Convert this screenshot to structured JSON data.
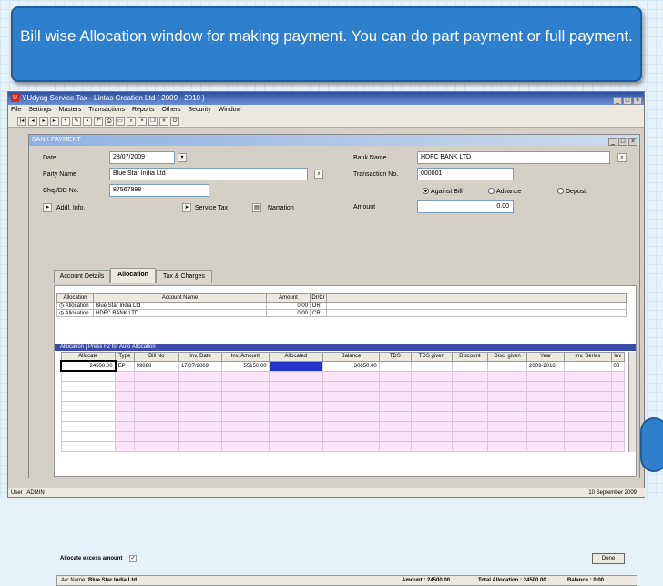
{
  "callout": {
    "text": "Bill wise Allocation window for making payment. You can do part payment or full payment."
  },
  "app": {
    "title": "YUdyog Service Tax  - Lintas Creation Ltd ( 2009 - 2010 )",
    "menu": [
      "File",
      "Settings",
      "Masters",
      "Transactions",
      "Reports",
      "Others",
      "Security",
      "Window"
    ]
  },
  "form": {
    "title": "BANK PAYMENT",
    "date_label": "Date",
    "date_value": "28/07/2009",
    "party_label": "Party Name",
    "party_value": "Blue Star India Ltd",
    "cheque_label": "Chq./DD No.",
    "cheque_value": "87567898",
    "addl_info": "Addl. Info.",
    "service_tax": "Service Tax",
    "narration": "Narration",
    "bank_label": "Bank Name",
    "bank_value": "HDFC BANK LTD",
    "trans_label": "Transaction No.",
    "trans_value": "000001",
    "radio_against": "Against Bill",
    "radio_advance": "Advance",
    "radio_deposit": "Deposit",
    "amount_label": "Amount",
    "amount_value": "0.00"
  },
  "tabs": [
    "Account Details",
    "Allocation",
    "Tax & Charges"
  ],
  "top_table": {
    "headers": [
      "Allocation",
      "Account Name",
      "Amount",
      "Dr/Cr"
    ],
    "rows": [
      {
        "alloc": "Allocation",
        "name": "Blue Star India Ltd",
        "amount": "0.00",
        "drcr": "DR"
      },
      {
        "alloc": "Allocation",
        "name": "HDFC BANK LTD",
        "amount": "0.00",
        "drcr": "CR"
      }
    ]
  },
  "alloc_bar": "Allocation    [ Press F2 for Auto Allocation ]",
  "grid": {
    "headers": [
      "Allocate",
      "Type",
      "Bill No",
      "Inv. Date",
      "Inv. Amount",
      "Allocated",
      "Balance",
      "TDS",
      "TDS given",
      "Discount",
      "Disc. given",
      "Year",
      "Inv. Series",
      "Inv"
    ],
    "row": {
      "allocate": "24500.00",
      "type": "EP",
      "bill_no": "99888",
      "inv_date": "17/07/2009",
      "inv_amount": "55150.00",
      "allocated": "",
      "balance": "30650.00",
      "year": "2009-2010",
      "inv": "00"
    }
  },
  "allocate_excess": "Allocate excess amount",
  "done_label": "Done",
  "footer": {
    "ac_name_label": "A/c Name :",
    "ac_name": "Blue Star India Ltd",
    "amount": "Amount : 24500.00",
    "total_alloc": "Total Allocation : 24500.00",
    "balance": "Balance : 0.00"
  },
  "status": {
    "user": "User : ADMIN",
    "date": "10 September 2009"
  }
}
